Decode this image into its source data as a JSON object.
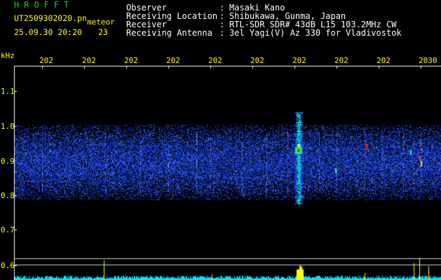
{
  "app_title": "HROFFT",
  "file": {
    "name": "UT2509302020.pn",
    "type": "meteor",
    "datetime": "25.09.30 20:20",
    "count": "23"
  },
  "info": {
    "labels": [
      "Observer",
      "Receiving Location",
      "Receiver",
      "Receiving Antenna"
    ],
    "colons": [
      ":",
      ":",
      ":",
      ":"
    ],
    "values": [
      "Masaki Kano",
      "Shibukawa, Gunma, Japan",
      "RTL-SDR SDR# 43dB L15 103.2MHz CW",
      "3el Yagi(V) Az 330 for Vladivostok"
    ]
  },
  "y_axis": {
    "unit": "kHz",
    "ticks": [
      "1.1",
      "1.0",
      "0.9",
      "0.8",
      "0.7",
      "0.6"
    ]
  },
  "x_axis": {
    "ticks": [
      "202",
      "202",
      "202",
      "202",
      "202",
      "202",
      "202",
      "202",
      "202",
      "2030"
    ]
  },
  "colors": {
    "background": "#000000",
    "text": "#ffffff",
    "accent": "#ffff00",
    "title": "#22cc22",
    "noise": "#1a3cff",
    "meteor": "#00ff66",
    "level": "#00e5ff"
  }
}
